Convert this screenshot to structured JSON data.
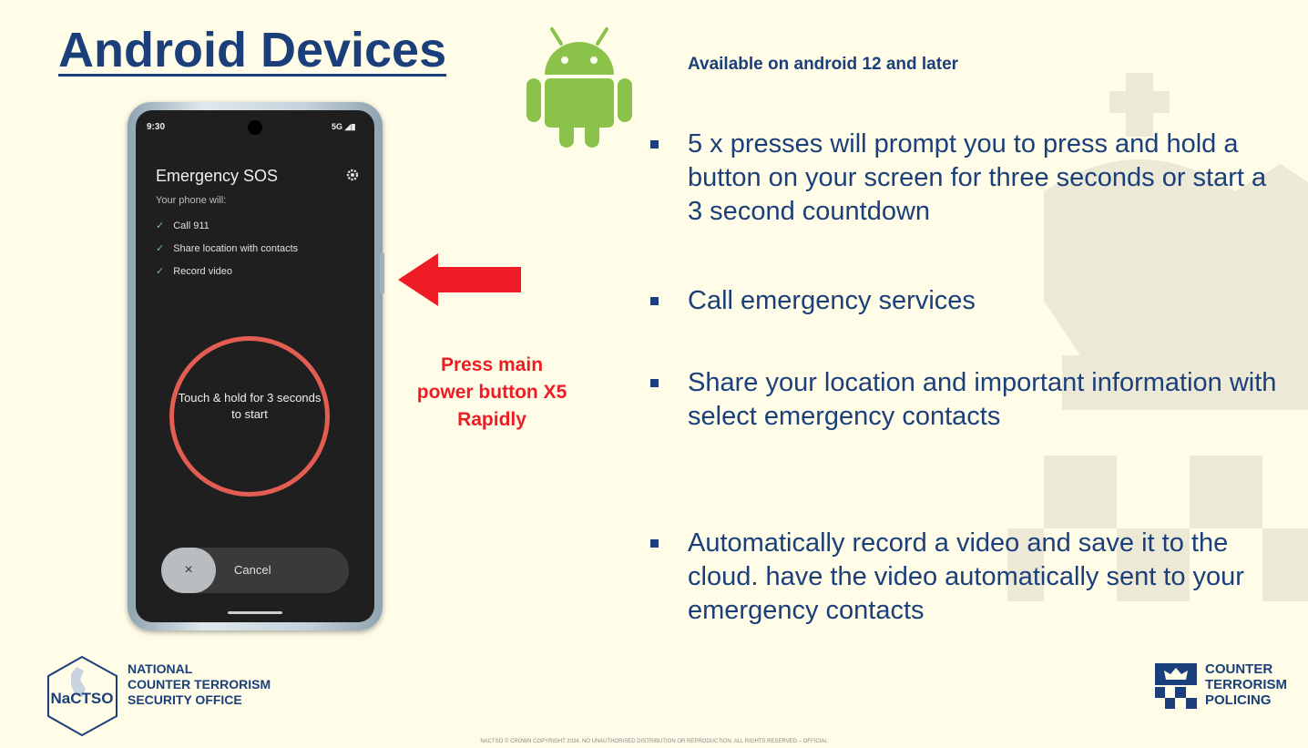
{
  "slide": {
    "title": "Android Devices",
    "availability_note": "Available on android 12 and later",
    "instruction": "Press main power button  X5 Rapidly",
    "bullets": [
      "5 x presses will prompt you to press and hold a button on your screen for three seconds or start a 3 second countdown",
      "Call emergency services",
      "Share your location and important information with select emergency contacts",
      "Automatically record a video and save it to the cloud. have the video automatically sent to your emergency contacts"
    ]
  },
  "phone_screen": {
    "status_time": "9:30",
    "status_network": "5G",
    "title": "Emergency SOS",
    "subtitle": "Your phone will:",
    "actions": [
      "Call 911",
      "Share location with contacts",
      "Record video"
    ],
    "button_text": "Touch & hold for 3 seconds to start",
    "cancel_label": "Cancel",
    "cancel_icon": "×"
  },
  "icons": {
    "android_logo": "android-icon",
    "arrow": "red-arrow-left",
    "settings": "gear-icon",
    "check": "✓"
  },
  "footer": {
    "nactso_abbr": "NaCTSO",
    "nactso_name": [
      "NATIONAL",
      "COUNTER TERRORISM",
      "SECURITY OFFICE"
    ],
    "ctp_name": [
      "COUNTER",
      "TERRORISM",
      "POLICING"
    ],
    "copyright": "NACTSO © CROWN COPYRIGHT 2024.  NO UNAUTHORISED DISTRIBUTION OR REPRODUCTION.  ALL RIGHTS RESERVED – OFFICIAL"
  },
  "colors": {
    "background": "#fffde8",
    "title_blue": "#1b3f7a",
    "android_green": "#8bc34a",
    "alert_red": "#ee1c24",
    "sos_ring": "#e35d52"
  }
}
